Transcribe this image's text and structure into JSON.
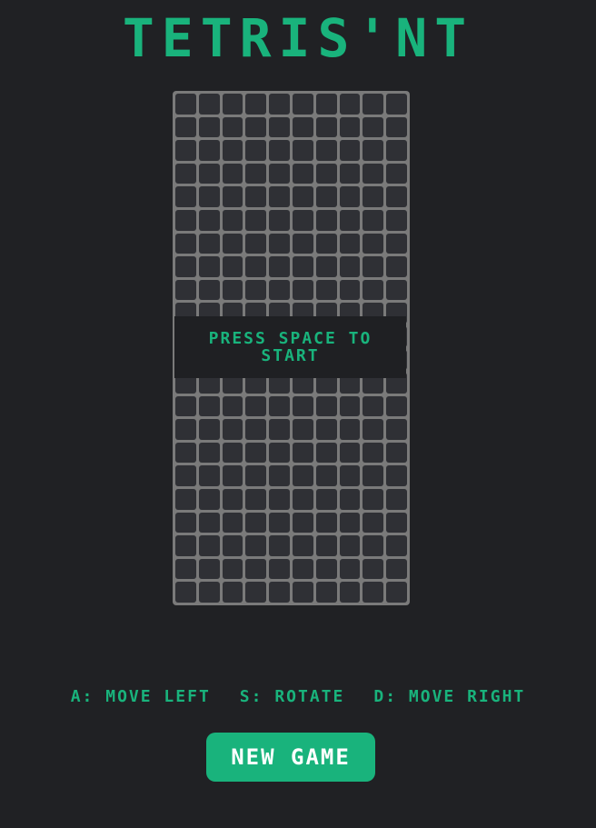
{
  "app": {
    "title": "TETRIS'NT"
  },
  "board": {
    "columns": 10,
    "rows": 22,
    "overlay_text": "PRESS SPACE TO START"
  },
  "controls": [
    {
      "key": "A:",
      "action": "MOVE LEFT"
    },
    {
      "key": "S:",
      "action": "ROTATE"
    },
    {
      "key": "D:",
      "action": "MOVE RIGHT"
    }
  ],
  "new_game_button": {
    "label": "NEW GAME"
  },
  "colors": {
    "background": "#202124",
    "accent": "#19b37c",
    "cell": "#2f3035",
    "grid": "#7a7a7a"
  }
}
